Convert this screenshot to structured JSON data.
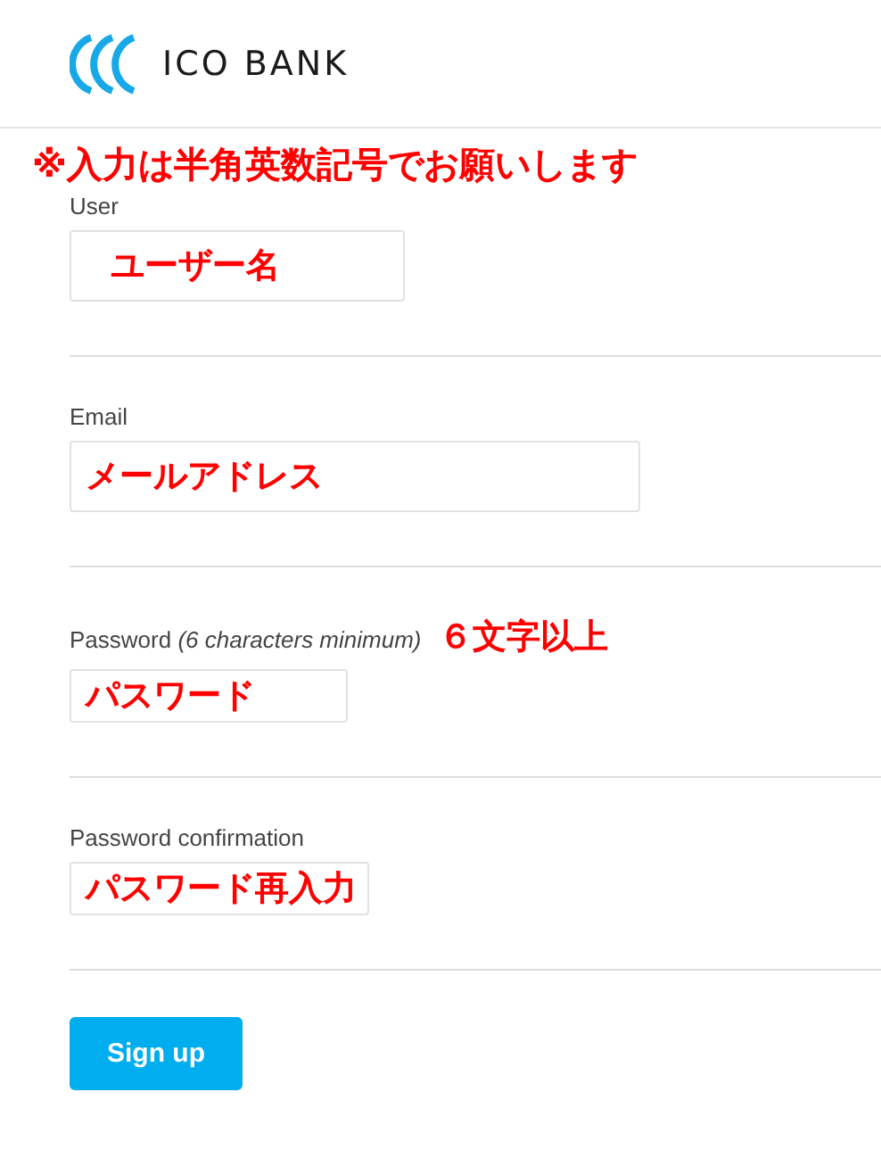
{
  "header": {
    "logo_text": "ICO BANK"
  },
  "notice": "※入力は半角英数記号でお願いします",
  "fields": [
    {
      "label": "User",
      "value": "ユーザー名",
      "kind": "text"
    },
    {
      "label": "Email",
      "value": "メールアドレス",
      "kind": "email"
    },
    {
      "label": "Password *(6 characters minimum)*",
      "note": "６文字以上",
      "value": "パスワード",
      "kind": "password"
    },
    {
      "label": "Password confirmation",
      "value": "パスワード再入力",
      "kind": "password"
    }
  ],
  "submit": {
    "label": "Sign up"
  }
}
